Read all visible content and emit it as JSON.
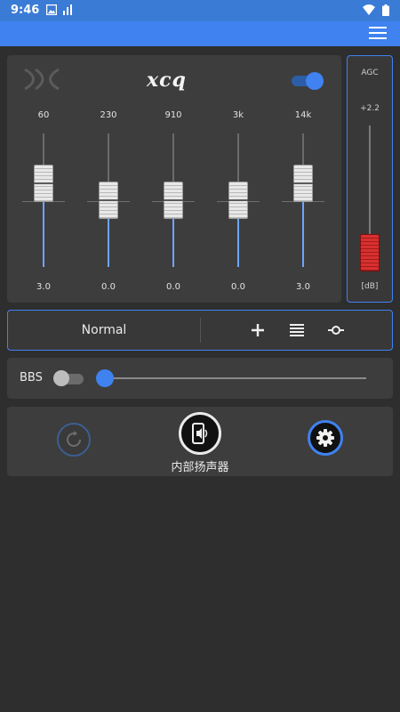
{
  "status_bar": {
    "time": "9:46",
    "left_icons": [
      "photo-icon",
      "signal-bars-icon"
    ],
    "right_icons": [
      "wifi-icon",
      "battery-icon"
    ]
  },
  "app_bar": {
    "menu_icon": "hamburger-menu-icon",
    "color": "#3f82f0"
  },
  "equalizer": {
    "logo_text": "xcq",
    "enabled": true,
    "bands": [
      {
        "freq": "60",
        "gain": "3.0",
        "gain_value": 3.0
      },
      {
        "freq": "230",
        "gain": "0.0",
        "gain_value": 0.0
      },
      {
        "freq": "910",
        "gain": "0.0",
        "gain_value": 0.0
      },
      {
        "freq": "3k",
        "gain": "0.0",
        "gain_value": 0.0
      },
      {
        "freq": "14k",
        "gain": "3.0",
        "gain_value": 3.0
      }
    ]
  },
  "agc": {
    "label": "AGC",
    "value": "+2.2",
    "unit": "[dB]"
  },
  "preset": {
    "name": "Normal",
    "icons": [
      "add-icon",
      "list-icon",
      "slider-icon"
    ]
  },
  "bbs": {
    "label": "BBS",
    "enabled": false,
    "level": 0.0
  },
  "bottom": {
    "device_label": "内部扬声器",
    "icons": [
      "reset-icon",
      "speaker-icon",
      "settings-icon"
    ]
  },
  "colors": {
    "accent": "#3f82f0",
    "agc_knob": "#d93030",
    "panel": "#3d3d3d",
    "background": "#2e2e2e"
  }
}
